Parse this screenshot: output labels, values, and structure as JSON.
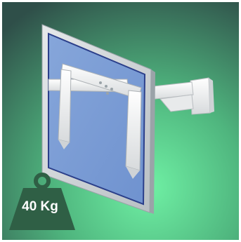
{
  "product_image": {
    "subject": "monitor-wall-mount-arm",
    "colors": {
      "background_green": "#5fd08a",
      "background_dark": "#2f4a43",
      "monitor_frame": "#cfd5d8",
      "screen_blue": "#7f9fd4",
      "bracket_white": "#f2f3f4",
      "weight_icon": "#2f5f45"
    }
  },
  "badge": {
    "icon": "weight-icon",
    "label": "40 Kg"
  }
}
